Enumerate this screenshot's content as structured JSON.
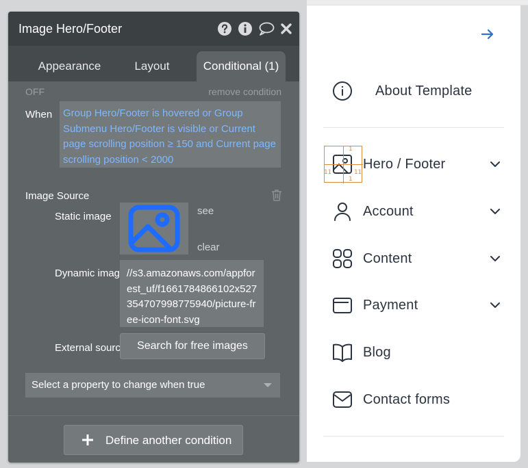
{
  "panel": {
    "title": "Image Hero/Footer",
    "header_icons": [
      "help-icon",
      "info-icon",
      "comment-icon",
      "close-icon"
    ],
    "tabs": [
      {
        "label": "Appearance",
        "active": false
      },
      {
        "label": "Layout",
        "active": false
      },
      {
        "label": "Conditional (1)",
        "active": true
      }
    ],
    "condition": {
      "status": "OFF",
      "remove_label": "remove condition",
      "when_label": "When",
      "expression": "Group Hero/Footer is hovered or Group Submenu Hero/Footer is visible or Current page scrolling position ≥ 150 and Current page scrolling position < 2000"
    },
    "image_source": {
      "label": "Image Source",
      "static_label": "Static image",
      "see_label": "see",
      "clear_label": "clear",
      "dynamic_label": "Dynamic image",
      "dynamic_value": "//s3.amazonaws.com/appforest_uf/f1661784866102x527354707998775940/picture-free-icon-font.svg",
      "external_label": "External source",
      "search_button": "Search for free images"
    },
    "property_select": "Select a property to change when true",
    "define_button": "Define another condition"
  },
  "preview": {
    "menu": [
      {
        "label": "About Template",
        "icon": "info-circle-icon",
        "has_chevron": false
      },
      {
        "label": "Hero / Footer",
        "icon": "image-icon",
        "has_chevron": true
      },
      {
        "label": "Account",
        "icon": "user-icon",
        "has_chevron": true
      },
      {
        "label": "Content",
        "icon": "grid-icon",
        "has_chevron": true
      },
      {
        "label": "Payment",
        "icon": "wallet-icon",
        "has_chevron": true
      },
      {
        "label": "Blog",
        "icon": "book-icon",
        "has_chevron": false
      },
      {
        "label": "Contact forms",
        "icon": "mail-icon",
        "has_chevron": false
      }
    ],
    "selection_markers": [
      "1",
      "11",
      "1",
      "11"
    ]
  },
  "colors": {
    "panel_bg": "#5f6466",
    "header_bg": "#3b4043",
    "condition_text": "#7fb7ff",
    "accent_blue": "#2f6fd6",
    "selection_orange": "#e08a3a"
  }
}
